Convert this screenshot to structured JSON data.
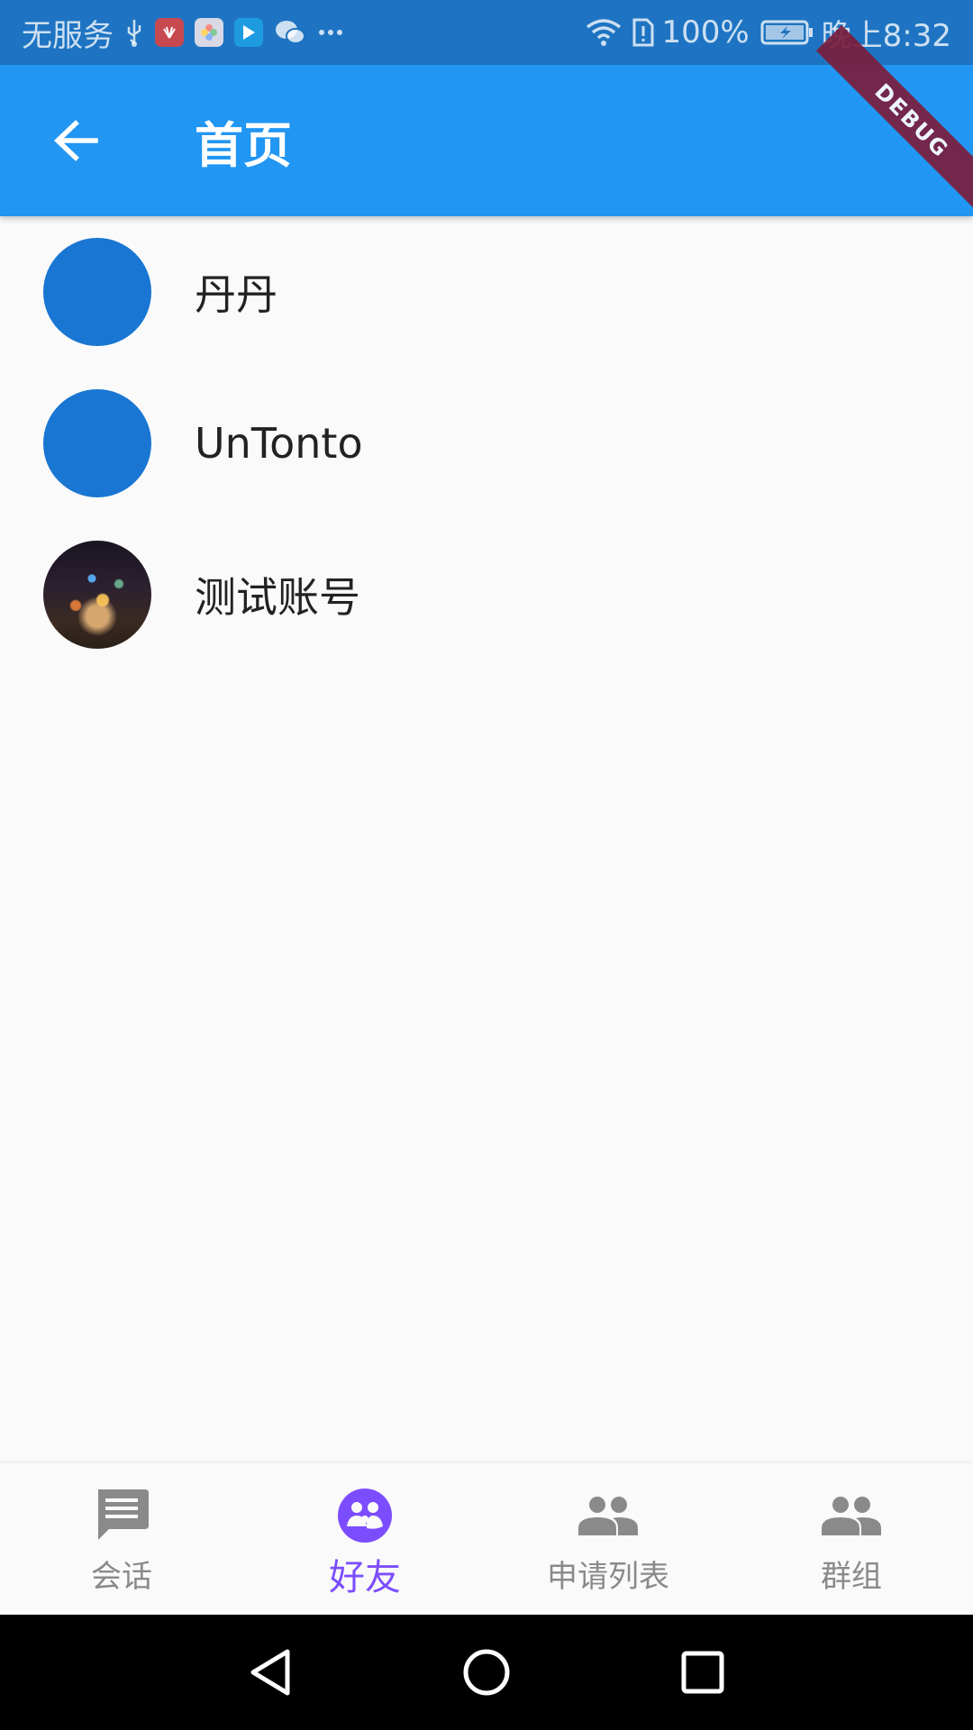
{
  "status_bar": {
    "carrier": "无服务",
    "battery_percent": "100%",
    "time": "晚上8:32",
    "icons": [
      "usb-icon",
      "huawei-app-icon",
      "gallery-app-icon",
      "video-app-icon",
      "wechat-icon",
      "more-icon",
      "wifi-icon",
      "sim-alert-icon",
      "battery-charging-icon"
    ]
  },
  "debug_banner": "DEBUG",
  "app_bar": {
    "title": "首页",
    "back_icon": "arrow-back-icon"
  },
  "contacts": [
    {
      "name": "丹丹",
      "avatar": "blue-circle"
    },
    {
      "name": "UnTonto",
      "avatar": "blue-circle"
    },
    {
      "name": "测试账号",
      "avatar": "city-night-photo"
    }
  ],
  "bottom_nav": {
    "active_index": 1,
    "items": [
      {
        "label": "会话",
        "icon": "chat-icon"
      },
      {
        "label": "好友",
        "icon": "friends-icon"
      },
      {
        "label": "申请列表",
        "icon": "people-icon"
      },
      {
        "label": "群组",
        "icon": "group-icon"
      }
    ]
  },
  "colors": {
    "status_bar": "#1e74c2",
    "app_bar": "#2196f3",
    "avatar": "#1976d2",
    "active_tab": "#7c4dff",
    "inactive_tab": "#8a8a8a"
  }
}
